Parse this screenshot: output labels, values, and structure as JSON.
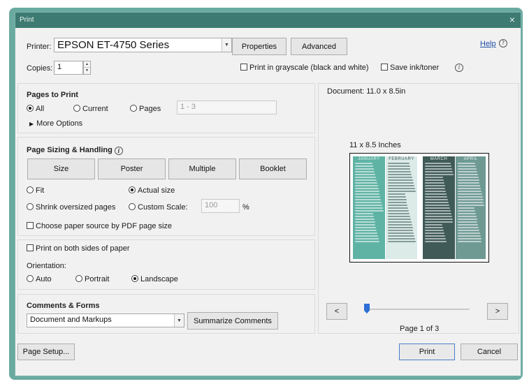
{
  "window": {
    "title": "Print",
    "close_glyph": "×"
  },
  "printer": {
    "label": "Printer:",
    "selected": "EPSON ET-4750 Series",
    "properties_label": "Properties",
    "advanced_label": "Advanced",
    "help_label": "Help",
    "help_icon_glyph": "?"
  },
  "copies": {
    "label": "Copies:",
    "value": "1"
  },
  "options": {
    "grayscale_label": "Print in grayscale (black and white)",
    "grayscale_checked": false,
    "save_ink_label": "Save ink/toner",
    "save_ink_checked": false,
    "info_glyph": "i"
  },
  "pages_to_print": {
    "title": "Pages to Print",
    "all_label": "All",
    "current_label": "Current",
    "pages_label": "Pages",
    "pages_range": "1 - 3",
    "selected": "all",
    "more_options_label": "More Options"
  },
  "page_sizing": {
    "title": "Page Sizing & Handling",
    "buttons": [
      "Size",
      "Poster",
      "Multiple",
      "Booklet"
    ],
    "fit_label": "Fit",
    "actual_size_label": "Actual size",
    "shrink_label": "Shrink oversized pages",
    "custom_scale_label": "Custom Scale:",
    "custom_scale_value": "100",
    "percent_sign": "%",
    "selected": "actual_size",
    "paper_source_label": "Choose paper source by PDF page size",
    "paper_source_checked": false
  },
  "duplex": {
    "label": "Print on both sides of paper",
    "checked": false
  },
  "orientation": {
    "title": "Orientation:",
    "auto_label": "Auto",
    "portrait_label": "Portrait",
    "landscape_label": "Landscape",
    "selected": "landscape"
  },
  "comments": {
    "title": "Comments & Forms",
    "selected": "Document and Markups",
    "summarize_label": "Summarize Comments"
  },
  "preview": {
    "document_size": "Document: 11.0 x 8.5in",
    "page_size_label": "11 x 8.5 Inches",
    "months": [
      "JANUARY",
      "FEBRUARY",
      "MARCH",
      "APRIL"
    ],
    "month_colors": [
      "#5fb3a5",
      "#dcebe8",
      "#3f5a57",
      "#6f9a94"
    ],
    "prev_glyph": "<",
    "next_glyph": ">",
    "page_indicator": "Page 1 of 3",
    "current_page": 1,
    "total_pages": 3
  },
  "footer": {
    "page_setup_label": "Page Setup...",
    "print_label": "Print",
    "cancel_label": "Cancel"
  }
}
